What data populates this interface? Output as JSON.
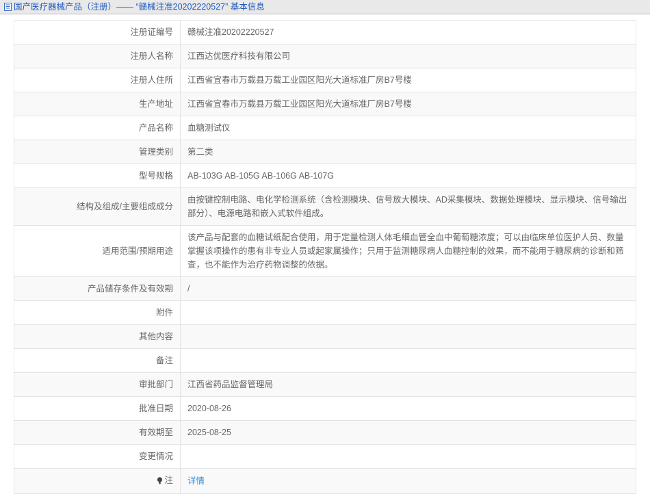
{
  "header": {
    "icon": "document-icon",
    "title": "国产医疗器械产品（注册）—— “赣械注准20202220527” 基本信息",
    "title_color": "#1f5bbf",
    "background_color": "#e9e9e9"
  },
  "table": {
    "rows": [
      {
        "label": "注册证编号",
        "value": "赣械注准20202220527"
      },
      {
        "label": "注册人名称",
        "value": "江西达优医疗科技有限公司"
      },
      {
        "label": "注册人住所",
        "value": "江西省宜春市万载县万载工业园区阳光大道标准厂房B7号楼"
      },
      {
        "label": "生产地址",
        "value": "江西省宜春市万载县万载工业园区阳光大道标准厂房B7号楼"
      },
      {
        "label": "产品名称",
        "value": "血糖测试仪"
      },
      {
        "label": "管理类别",
        "value": "第二类"
      },
      {
        "label": "型号规格",
        "value": "AB-103G AB-105G AB-106G AB-107G"
      },
      {
        "label": "结构及组成/主要组成成分",
        "value": "由按键控制电路、电化学检测系统（含检测模块、信号放大模块、AD采集模块、数据处理模块、显示模块、信号输出部分）、电源电路和嵌入式软件组成。"
      },
      {
        "label": "适用范围/预期用途",
        "value": "该产品与配套的血糖试纸配合使用，用于定量检测人体毛细血管全血中葡萄糖浓度；可以由临床单位医护人员、数量掌握该项操作的患有非专业人员或起家属操作；只用于监测糖尿病人血糖控制的效果，而不能用于糖尿病的诊断和筛查，也不能作为治疗药物调整的依据。"
      },
      {
        "label": "产品储存条件及有效期",
        "value": "/"
      },
      {
        "label": "附件",
        "value": ""
      },
      {
        "label": "其他内容",
        "value": ""
      },
      {
        "label": "备注",
        "value": ""
      },
      {
        "label": "审批部门",
        "value": "江西省药品监督管理局"
      },
      {
        "label": "批准日期",
        "value": "2020-08-26"
      },
      {
        "label": "有效期至",
        "value": "2025-08-25"
      },
      {
        "label": "变更情况",
        "value": ""
      }
    ],
    "note_row": {
      "icon": "bulb-icon",
      "label": "注",
      "link_text": "详情",
      "link_color": "#3c8ddc"
    }
  }
}
